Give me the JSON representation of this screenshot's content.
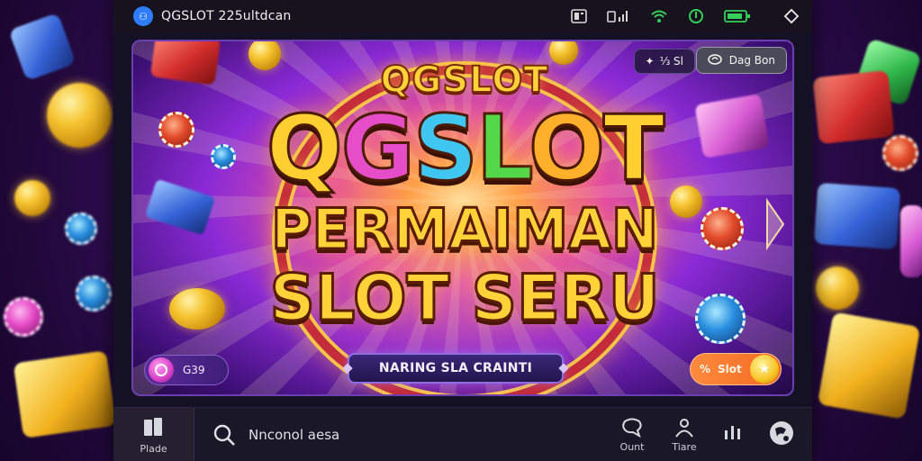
{
  "status_bar": {
    "app_logo_text": "⚇",
    "app_title": "QGSLOT 225ultdcan",
    "icons": [
      "screenshot-icon",
      "signal-bars-icon",
      "wifi-icon",
      "power-icon",
      "battery-icon",
      "diamond-icon"
    ],
    "colors": {
      "wifi": "#35d05a",
      "battery": "#35d05a"
    }
  },
  "banner": {
    "logo_small": "QGSLOT",
    "logo_big_letters": [
      "Q",
      "G",
      "S",
      "L",
      "O",
      "T"
    ],
    "headline_line1": "PERMAIMAN",
    "headline_line2": "SLOT SERU",
    "top_chip_1": "⅓ Sl",
    "top_chip_2": "Dag Bon",
    "coins_label": "G39",
    "cta_label": "NARING SLA CRAINTI",
    "slot_button_label": "Slot",
    "slot_button_prefix": "%",
    "slot_star": "★"
  },
  "bottom_nav": {
    "home_label": "Plade",
    "search_placeholder": "Nnconol aesa",
    "items": [
      {
        "id": "chat",
        "label": "Ount"
      },
      {
        "id": "guide",
        "label": "Tiare"
      },
      {
        "id": "stats",
        "label": ""
      },
      {
        "id": "profile",
        "label": ""
      }
    ]
  }
}
